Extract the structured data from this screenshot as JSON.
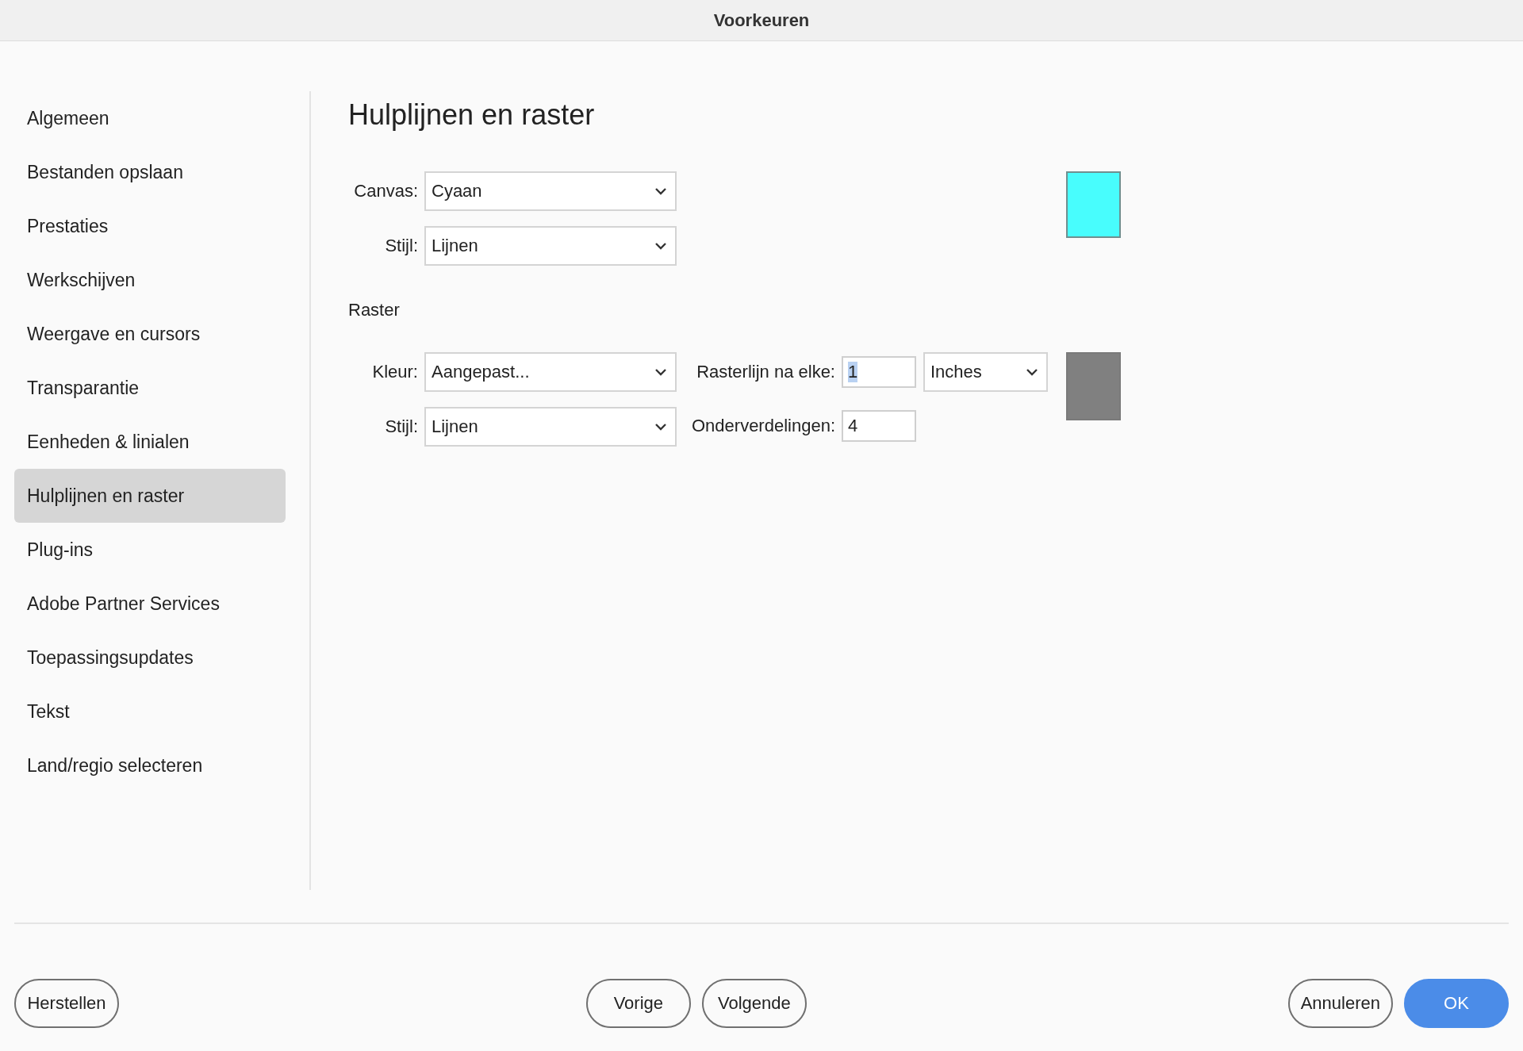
{
  "window": {
    "title": "Voorkeuren"
  },
  "sidebar": {
    "items": [
      {
        "label": "Algemeen",
        "selected": false
      },
      {
        "label": "Bestanden opslaan",
        "selected": false
      },
      {
        "label": "Prestaties",
        "selected": false
      },
      {
        "label": "Werkschijven",
        "selected": false
      },
      {
        "label": "Weergave en cursors",
        "selected": false
      },
      {
        "label": "Transparantie",
        "selected": false
      },
      {
        "label": "Eenheden & linialen",
        "selected": false
      },
      {
        "label": "Hulplijnen en raster",
        "selected": true
      },
      {
        "label": "Plug-ins",
        "selected": false
      },
      {
        "label": "Adobe Partner Services",
        "selected": false
      },
      {
        "label": "Toepassingsupdates",
        "selected": false
      },
      {
        "label": "Tekst",
        "selected": false
      },
      {
        "label": "Land/regio selecteren",
        "selected": false
      }
    ]
  },
  "heading": "Hulplijnen en raster",
  "guides": {
    "fields": [
      {
        "label": "Canvas:",
        "value": "Cyaan"
      },
      {
        "label": "Stijl:",
        "value": "Lijnen"
      }
    ],
    "swatch": {
      "color": "#48fdfd"
    }
  },
  "grid": {
    "title": "Raster",
    "fields": [
      {
        "label": "Kleur:",
        "value": "Aangepast..."
      },
      {
        "label": "Stijl:",
        "value": "Lijnen"
      }
    ],
    "gridline_every": {
      "label": "Rasterlijn na elke:",
      "value": "1",
      "text_selected": true,
      "unit": "Inches"
    },
    "subdivisions": {
      "label": "Onderverdelingen:",
      "value": "4"
    },
    "swatch": {
      "color": "#808080"
    }
  },
  "footer": {
    "left_buttons": [
      {
        "label": "Herstellen",
        "primary": false
      }
    ],
    "center_buttons": [
      {
        "label": "Vorige",
        "primary": false
      },
      {
        "label": "Volgende",
        "primary": false
      }
    ],
    "right_buttons": [
      {
        "label": "Annuleren",
        "primary": false
      },
      {
        "label": "OK",
        "primary": true
      }
    ]
  }
}
